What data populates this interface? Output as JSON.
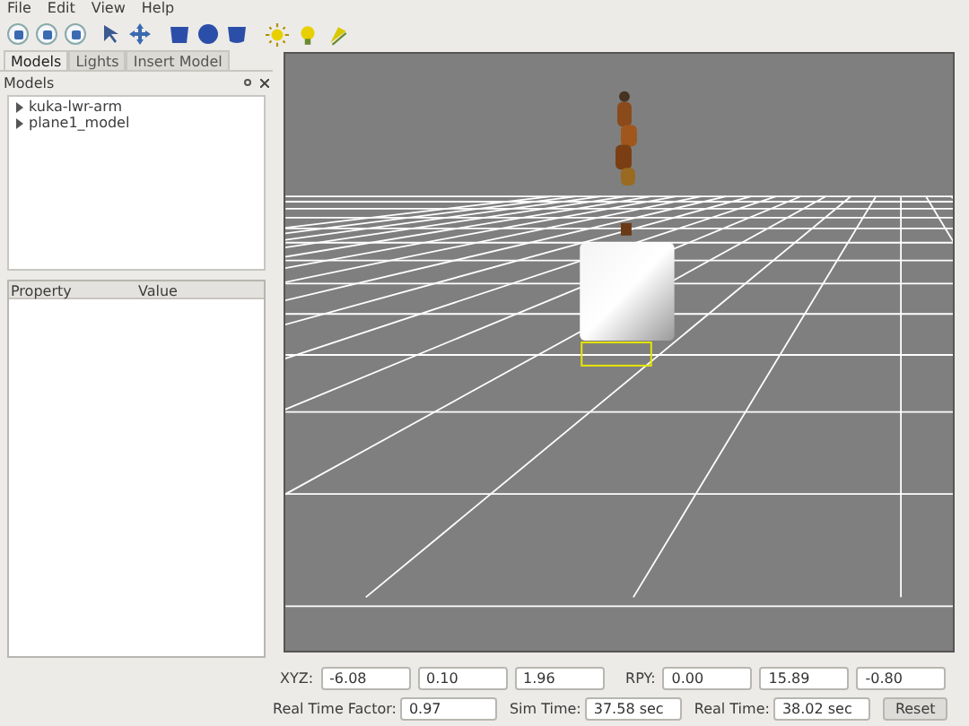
{
  "menu": [
    "File",
    "Edit",
    "View",
    "Help"
  ],
  "tabs": [
    {
      "label": "Models",
      "selected": true
    },
    {
      "label": "Lights",
      "selected": false
    },
    {
      "label": "Insert Model",
      "selected": false
    }
  ],
  "models_panel": {
    "title": "Models",
    "items": [
      {
        "label": "kuka-lwr-arm",
        "expanded": false
      },
      {
        "label": "plane1_model",
        "expanded": false
      }
    ]
  },
  "property_table": {
    "columns": [
      "Property",
      "Value"
    ]
  },
  "pose": {
    "xyz_label": "XYZ:",
    "xyz": [
      "-6.08",
      "0.10",
      "1.96"
    ],
    "rpy_label": "RPY:",
    "rpy": [
      "0.00",
      "15.89",
      "-0.80"
    ]
  },
  "time": [
    {
      "label": "Real Time Factor:",
      "value": "0.97"
    },
    {
      "label": "Sim Time:",
      "value": "37.58 sec"
    },
    {
      "label": "Real Time:",
      "value": "38.02 sec"
    }
  ],
  "reset_button": "Reset"
}
